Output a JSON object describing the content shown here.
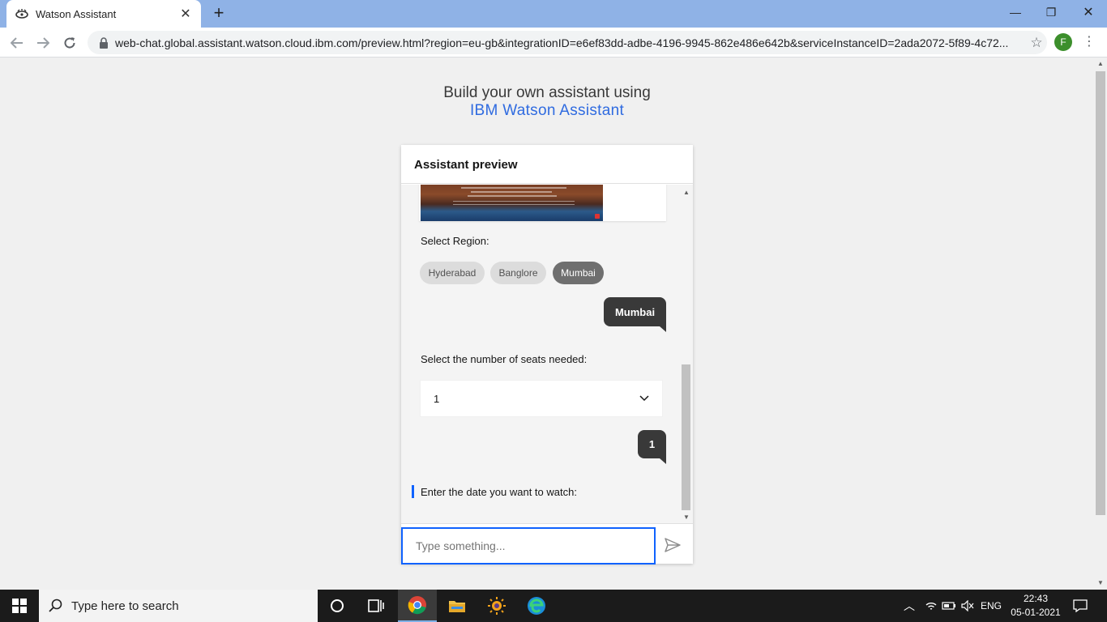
{
  "browser": {
    "tab_title": "Watson Assistant",
    "tab_close": "✕",
    "new_tab": "+",
    "url": "web-chat.global.assistant.watson.cloud.ibm.com/preview.html?region=eu-gb&integrationID=e6ef83dd-adbe-4196-9945-862e486e642b&serviceInstanceID=2ada2072-5f89-4c72...",
    "profile_initial": "F",
    "minimize": "—",
    "restore": "❐",
    "close": "✕"
  },
  "page": {
    "heading_line1": "Build your own assistant using",
    "heading_brand": "IBM Watson Assistant"
  },
  "widget": {
    "title": "Assistant preview",
    "select_region": "Select Region:",
    "region_chips": [
      "Hyderabad",
      "Banglore",
      "Mumbai"
    ],
    "selected_region": "Mumbai",
    "user_reply_region": "Mumbai",
    "seats_prompt": "Select the number of seats needed:",
    "seats_value": "1",
    "user_reply_seats": "1",
    "date_prompt": "Enter the date you want to watch:",
    "input_placeholder": "Type something..."
  },
  "taskbar": {
    "search_placeholder": "Type here to search",
    "language": "ENG",
    "time": "22:43",
    "date": "05-01-2021"
  },
  "colors": {
    "accent": "#0f62fe",
    "brand_text": "#2f6be0",
    "user_bubble": "#393939",
    "chip_selected": "#6f6f6f"
  }
}
